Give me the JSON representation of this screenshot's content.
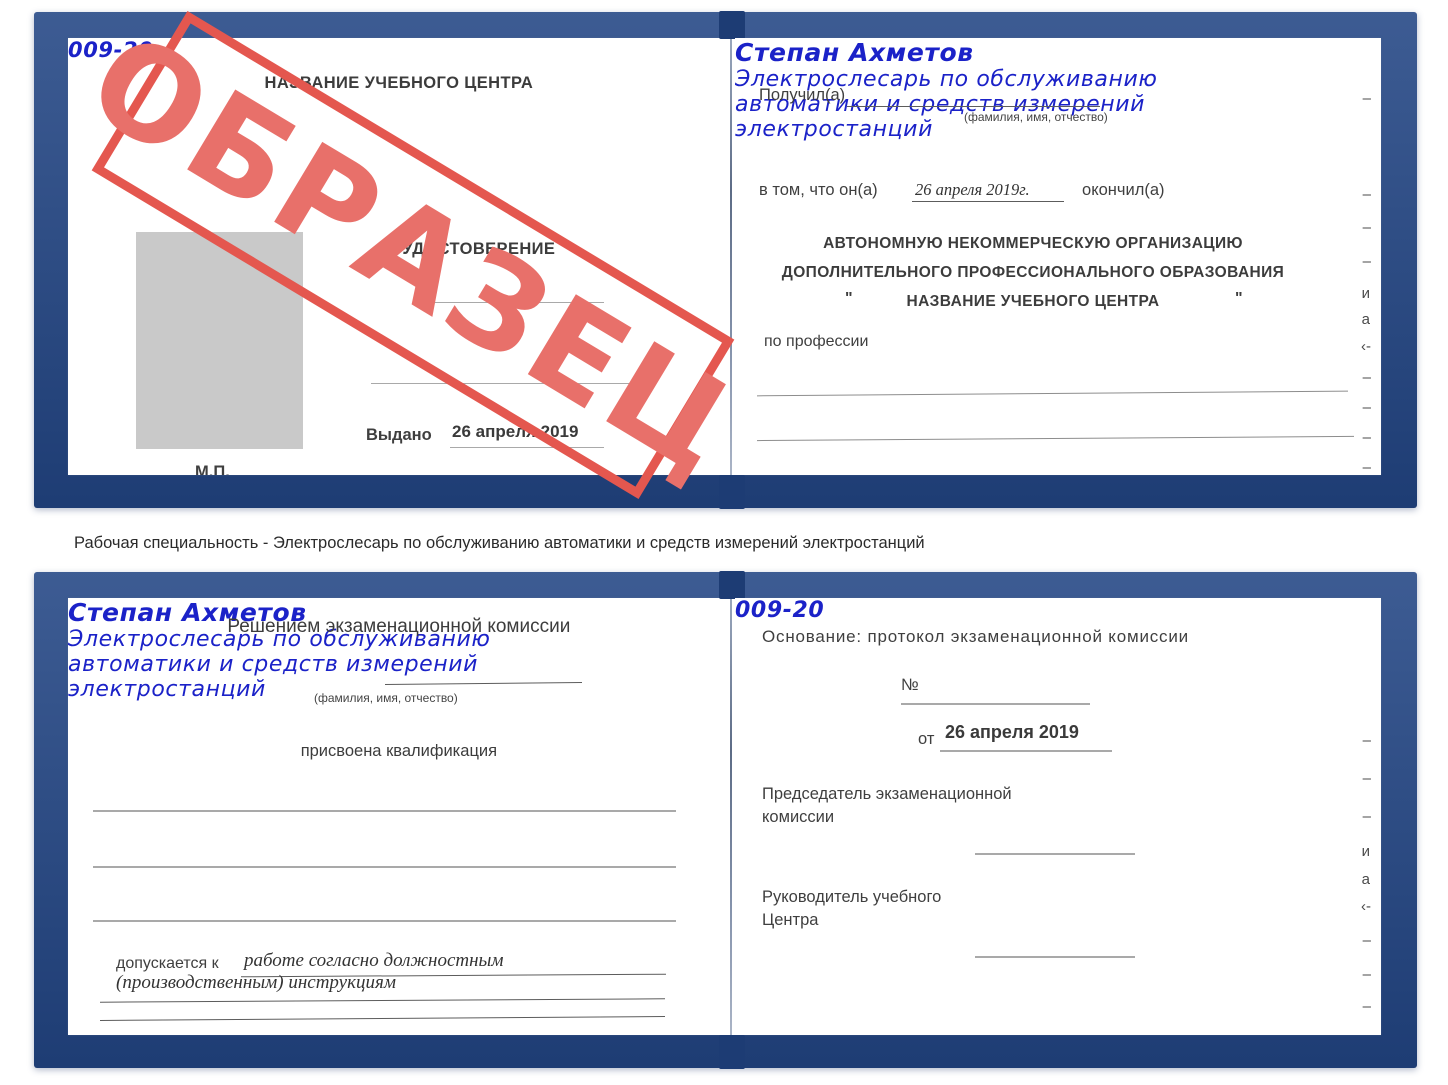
{
  "stamp": {
    "text": "ОБРАЗЕЦ",
    "border_color": "#e4574f",
    "text_color": "#e8706a"
  },
  "caption": {
    "text": "Рабочая специальность - Электрослесарь по обслуживанию автоматики и средств измерений электростанций"
  },
  "cert_top": {
    "left_page": {
      "header": "НАЗВАНИЕ УЧЕБНОГО ЦЕНТРА",
      "doc_type": "УДОСТОВЕРЕНИЕ",
      "number_label": "№",
      "number_value": "009-20",
      "issued_label": "Выдано",
      "issued_value": "26 апреля 2019",
      "seal_label": "М.П.",
      "photo_placeholder": "photo-box"
    },
    "right_page": {
      "received_label": "Получил(а)",
      "received_value": "Степан Ахметов",
      "received_hint": "(фамилия, имя, отчество)",
      "in_that_label": "в том, что он(а)",
      "in_that_value": "26 апреля 2019г.",
      "finished_label": "окончил(а)",
      "org_line1": "АВТОНОМНУЮ НЕКОММЕРЧЕСКУЮ ОРГАНИЗАЦИЮ",
      "org_line2": "ДОПОЛНИТЕЛЬНОГО ПРОФЕССИОНАЛЬНОГО ОБРАЗОВАНИЯ",
      "org_quote_open": "\"",
      "org_line3": "НАЗВАНИЕ УЧЕБНОГО ЦЕНТРА",
      "org_quote_close": "\"",
      "profession_label": "по профессии",
      "profession_line1": "Электрослесарь по обслуживанию",
      "profession_line2": "автоматики и средств измерений",
      "profession_line3": "электростанций",
      "edge_fragments": [
        "–",
        "–",
        "–",
        "и",
        "а",
        "‹-",
        "–",
        "–",
        "–",
        "–"
      ]
    }
  },
  "cert_bottom": {
    "left_page": {
      "decision_title": "Решением экзаменационной комиссии",
      "name_value": "Степан Ахметов",
      "name_hint": "(фамилия, имя, отчество)",
      "qualification_label": "присвоена квалификация",
      "qualification_line1": "Электрослесарь по обслуживанию",
      "qualification_line2": "автоматики и средств измерений",
      "qualification_line3": "электростанций",
      "allowed_label": "допускается к",
      "allowed_value1": "работе согласно должностным",
      "allowed_value2": "(производственным) инструкциям"
    },
    "right_page": {
      "basis_label": "Основание: протокол экзаменационной комиссии",
      "number_label": "№",
      "number_value": "009-20",
      "date_label": "от",
      "date_value": "26 апреля 2019",
      "chairman_line1": "Председатель экзаменационной",
      "chairman_line2": "комиссии",
      "head_line1": "Руководитель учебного",
      "head_line2": "Центра",
      "edge_fragments": [
        "–",
        "–",
        "–",
        "а",
        "‹-",
        "–",
        "–",
        "–"
      ]
    }
  }
}
